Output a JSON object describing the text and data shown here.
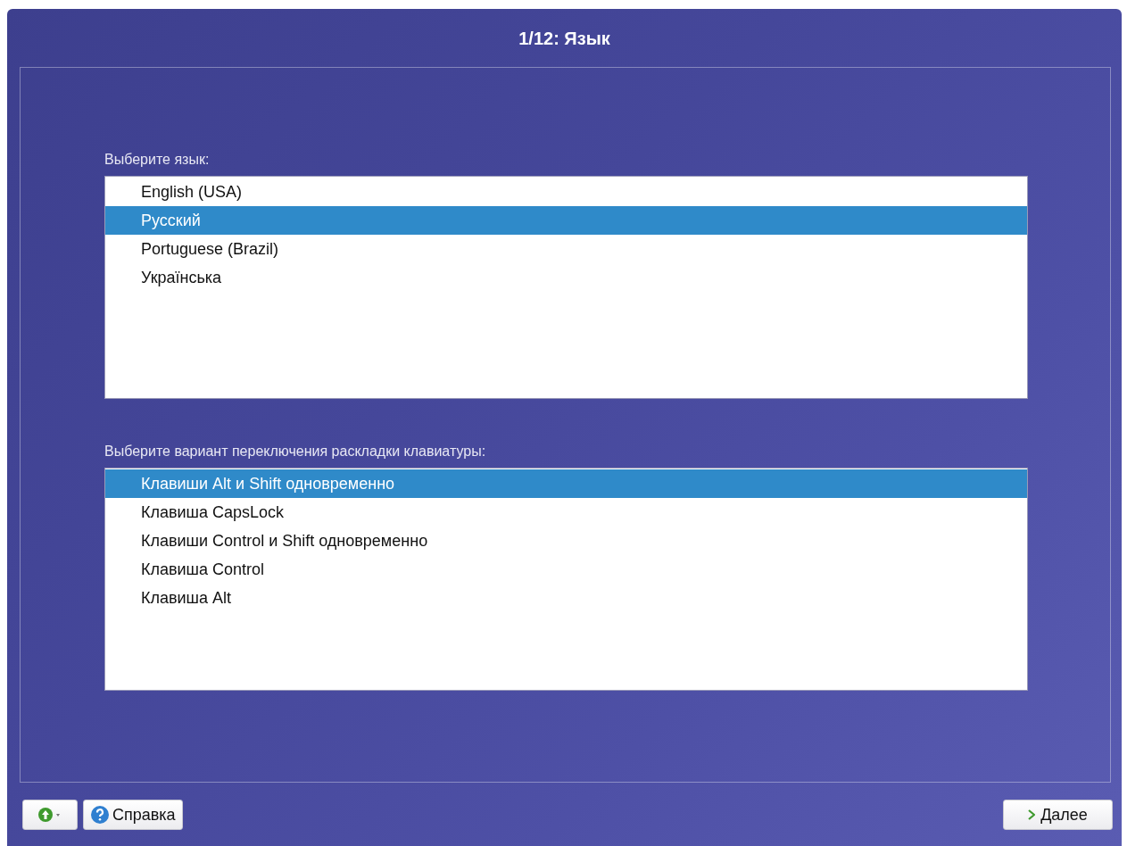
{
  "window": {
    "title": "1/12: Язык"
  },
  "language": {
    "label": "Выберите язык:",
    "items": [
      {
        "text": "English (USA)",
        "selected": false
      },
      {
        "text": "Русский",
        "selected": true
      },
      {
        "text": "Portuguese (Brazil)",
        "selected": false
      },
      {
        "text": "Українська",
        "selected": false
      }
    ]
  },
  "layout_switch": {
    "label": "Выберите вариант переключения раскладки клавиатуры:",
    "items": [
      {
        "text": "Клавиши Alt и Shift одновременно",
        "selected": true
      },
      {
        "text": "Клавиша CapsLock",
        "selected": false
      },
      {
        "text": "Клавиши Control и Shift одновременно",
        "selected": false
      },
      {
        "text": "Клавиша Control",
        "selected": false
      },
      {
        "text": "Клавиша Alt",
        "selected": false
      }
    ]
  },
  "buttons": {
    "help": "Справка",
    "next": "Далее"
  }
}
